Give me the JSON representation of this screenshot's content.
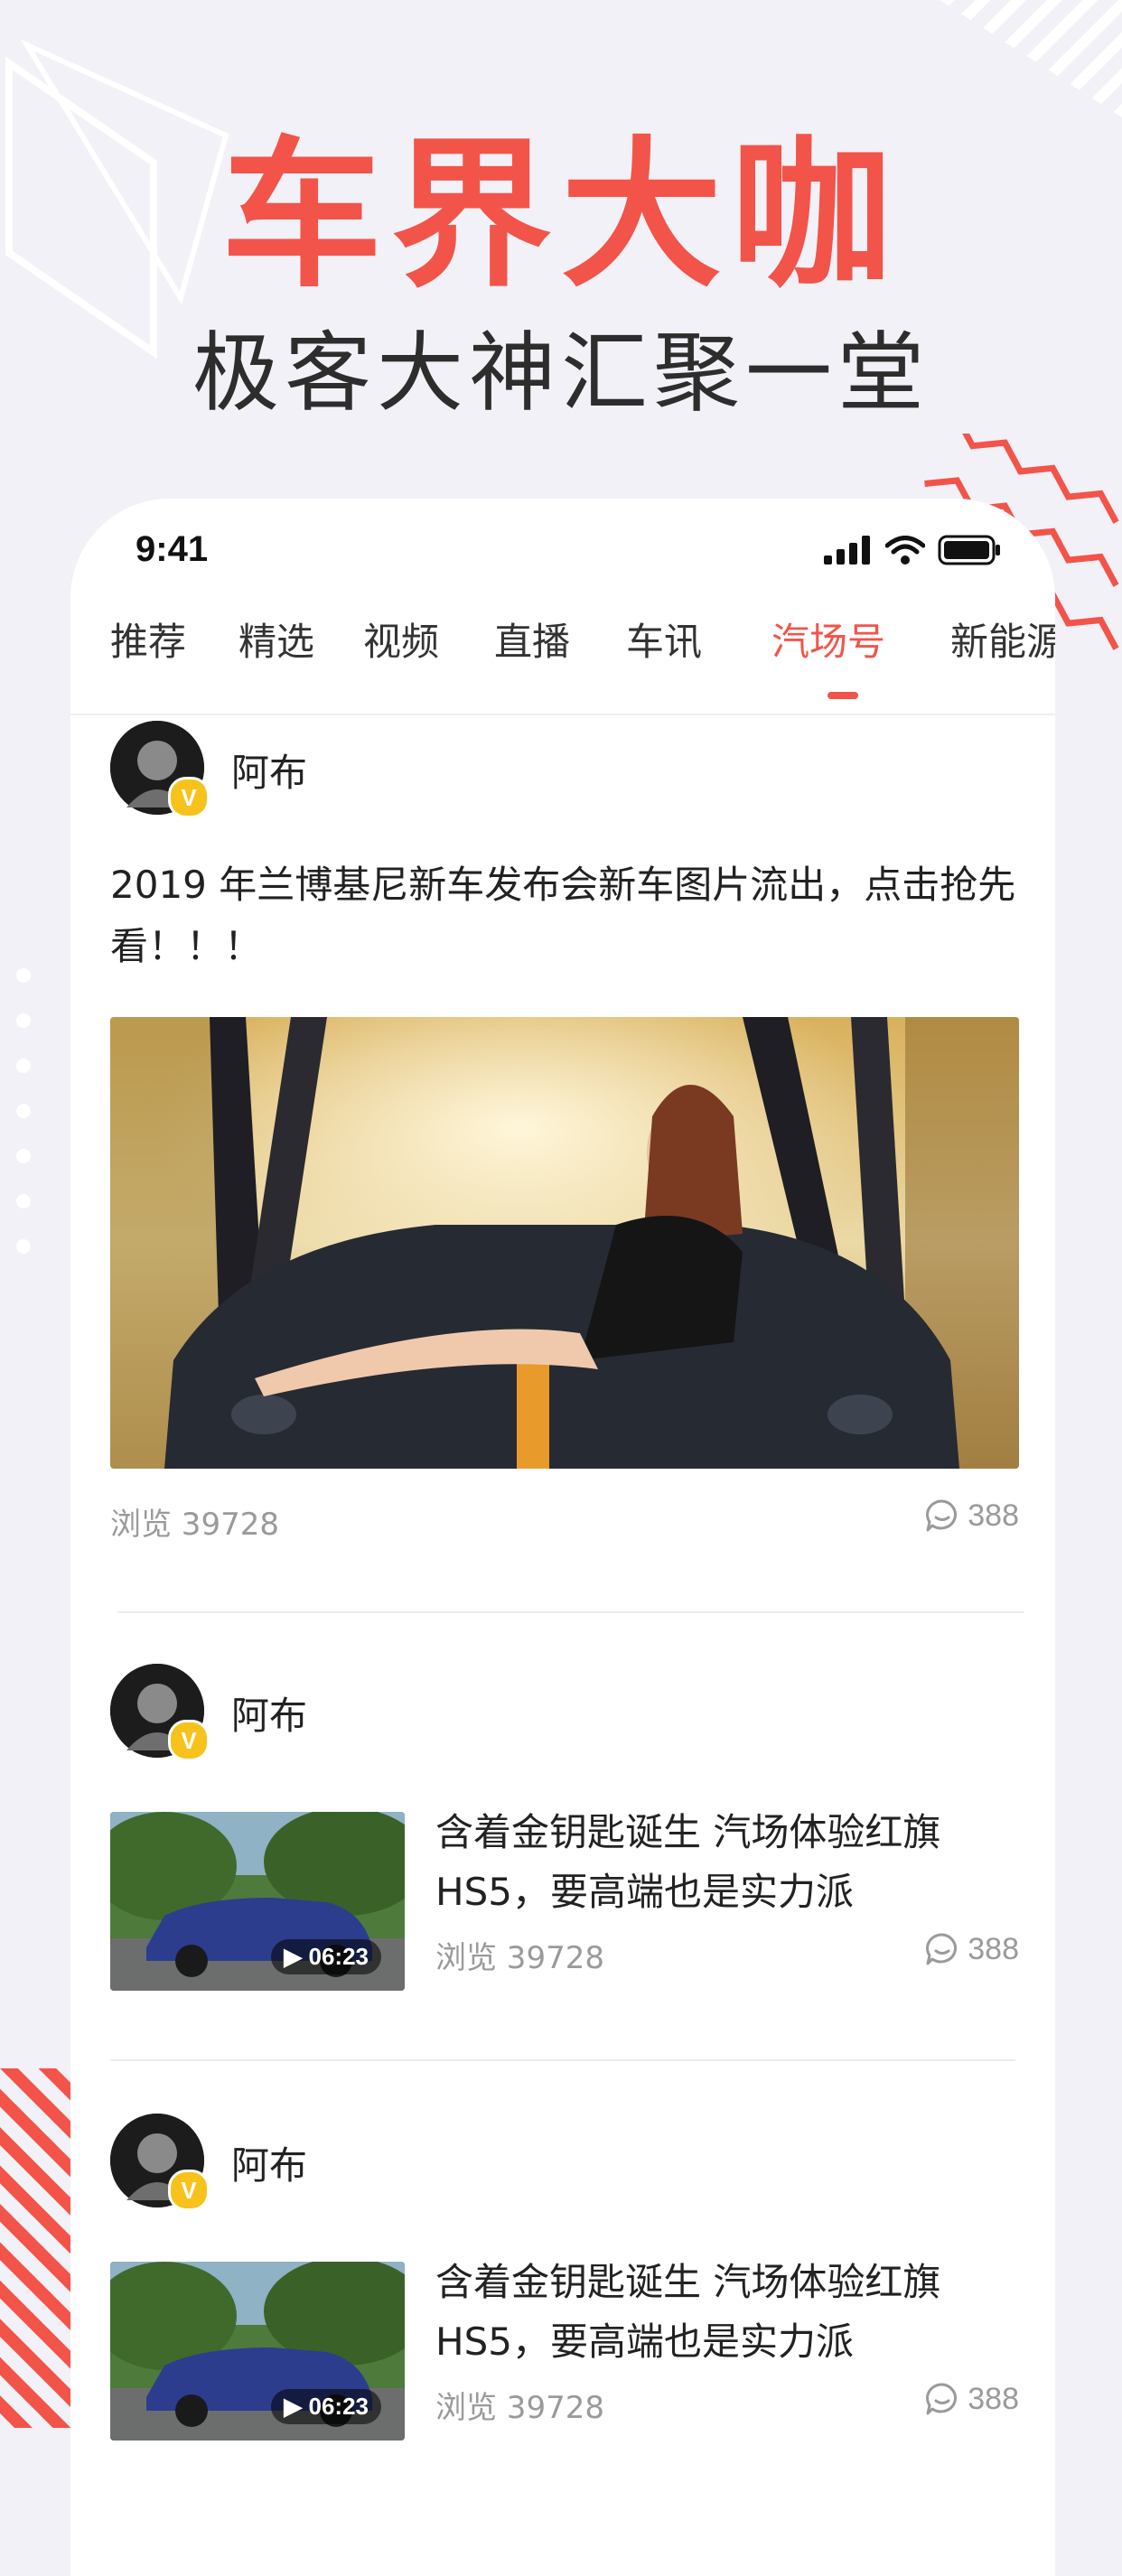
{
  "hero": {
    "title": "车界大咖",
    "subtitle": "极客大神汇聚一堂"
  },
  "colors": {
    "accent": "#F2544A",
    "badge": "#F7C21B",
    "background": "#F1F1F7"
  },
  "status_bar": {
    "time": "9:41"
  },
  "tabs": [
    {
      "label": "推荐"
    },
    {
      "label": "精选"
    },
    {
      "label": "视频"
    },
    {
      "label": "直播"
    },
    {
      "label": "车讯"
    },
    {
      "label": "汽场号",
      "active": true
    },
    {
      "label": "新能源"
    }
  ],
  "feed": {
    "post1": {
      "author": "阿布",
      "badge": "V",
      "text": "2019 年兰博基尼新车发布会新车图片流出，点击抢先看！！！",
      "views": "浏览 39728",
      "comments": "388"
    },
    "post2": {
      "author": "阿布",
      "badge": "V",
      "title": "含着金钥匙诞生 汽场体验红旗HS5，要高端也是实力派",
      "duration": "06:23",
      "views": "浏览 39728",
      "comments": "388"
    },
    "post3": {
      "author": "阿布",
      "badge": "V",
      "title": "含着金钥匙诞生 汽场体验红旗HS5，要高端也是实力派",
      "duration": "06:23",
      "views": "浏览 39728",
      "comments": "388"
    }
  },
  "icons": [
    "signal-icon",
    "wifi-icon",
    "battery-icon",
    "verified-badge-icon",
    "comment-icon",
    "play-icon"
  ]
}
